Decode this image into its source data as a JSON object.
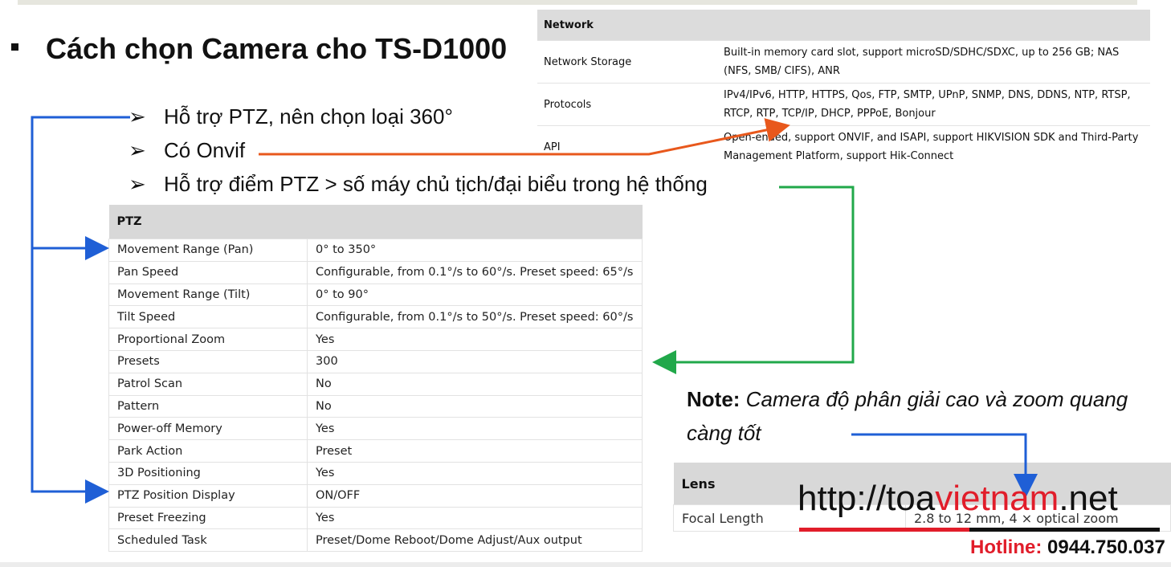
{
  "title": "Cách chọn Camera cho TS-D1000",
  "bullets": [
    "Hỗ trợ PTZ, nên chọn loại 360°",
    "Có Onvif",
    "Hỗ trợ điểm PTZ > số máy chủ tịch/đại biểu trong hệ thống"
  ],
  "bullet_glyph": "➢",
  "network_table": {
    "header": "Network",
    "rows": [
      {
        "key": "Network Storage",
        "value": "Built-in memory card slot, support microSD/SDHC/SDXC, up to 256 GB; NAS (NFS, SMB/ CIFS), ANR"
      },
      {
        "key": "Protocols",
        "value": "IPv4/IPv6, HTTP, HTTPS, Qos, FTP, SMTP, UPnP, SNMP, DNS, DDNS, NTP, RTSP, RTCP, RTP, TCP/IP, DHCP, PPPoE, Bonjour"
      },
      {
        "key": "API",
        "value": "Open-ended, support ONVIF, and ISAPI, support HIKVISION SDK and Third-Party Management Platform, support Hik-Connect"
      }
    ]
  },
  "ptz_table": {
    "header": "PTZ",
    "rows": [
      {
        "key": "Movement Range (Pan)",
        "value": "0° to 350°"
      },
      {
        "key": "Pan Speed",
        "value": "Configurable, from 0.1°/s to 60°/s. Preset speed: 65°/s"
      },
      {
        "key": "Movement Range (Tilt)",
        "value": "0° to 90°"
      },
      {
        "key": "Tilt Speed",
        "value": "Configurable, from 0.1°/s to 50°/s. Preset speed: 60°/s"
      },
      {
        "key": "Proportional Zoom",
        "value": "Yes"
      },
      {
        "key": "Presets",
        "value": "300"
      },
      {
        "key": "Patrol Scan",
        "value": "No"
      },
      {
        "key": "Pattern",
        "value": "No"
      },
      {
        "key": "Power-off Memory",
        "value": "Yes"
      },
      {
        "key": "Park Action",
        "value": "Preset"
      },
      {
        "key": "3D Positioning",
        "value": "Yes"
      },
      {
        "key": "PTZ Position Display",
        "value": "ON/OFF"
      },
      {
        "key": "Preset Freezing",
        "value": "Yes"
      },
      {
        "key": "Scheduled Task",
        "value": "Preset/Dome Reboot/Dome Adjust/Aux output"
      }
    ]
  },
  "note": {
    "label": "Note:",
    "text": "Camera độ phân giải cao và zoom quang càng tốt"
  },
  "lens_table": {
    "header": "Lens",
    "rows": [
      {
        "key": "Focal Length",
        "value": "2.8 to 12 mm, 4 × optical zoom"
      }
    ]
  },
  "watermark": {
    "prefix": "http://toa",
    "highlight": "vietnam",
    "suffix": ".net"
  },
  "hotline": {
    "label": "Hotline:",
    "number": "0944.750.037"
  },
  "colors": {
    "blue_arrow": "#1f5fd6",
    "orange_arrow": "#e8581c",
    "green_arrow": "#21a84a",
    "brand_red": "#e11d2a"
  }
}
